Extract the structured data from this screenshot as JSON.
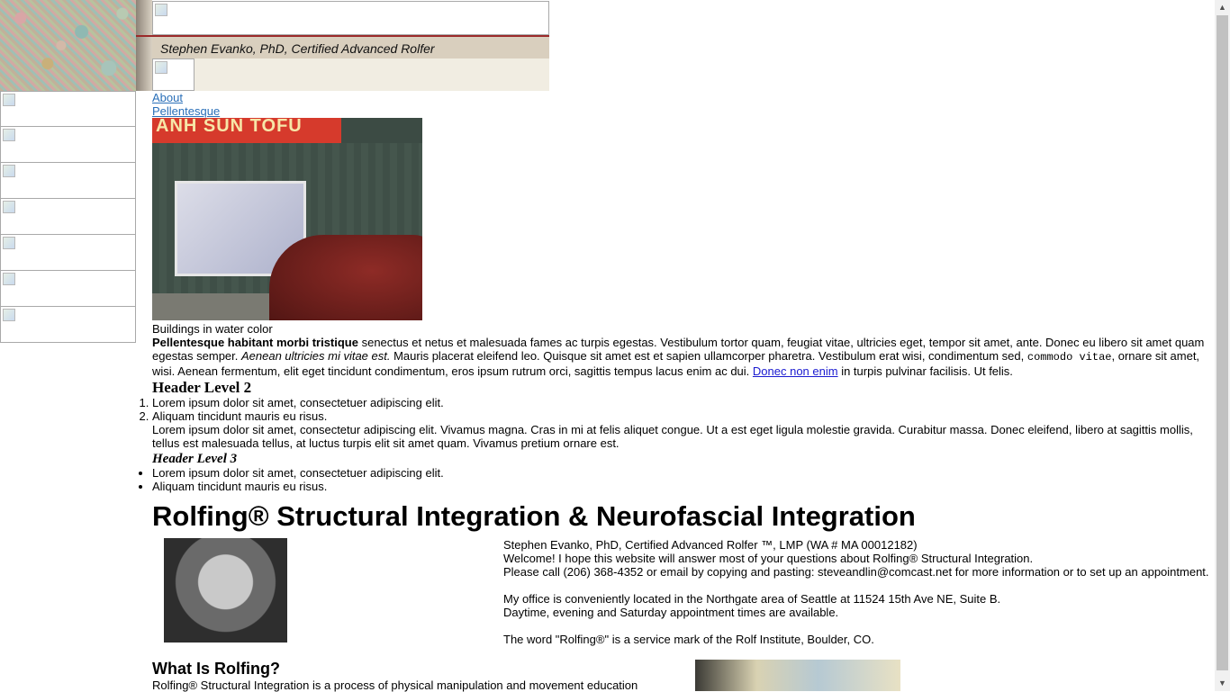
{
  "header": {
    "tagline": "Stephen Evanko, PhD, Certified Advanced Rolfer"
  },
  "nav": {
    "links": [
      "About",
      "Pellentesque"
    ]
  },
  "figure": {
    "sign_text": "ANH SUN TOFU",
    "caption": "Buildings in water color"
  },
  "article": {
    "p_bold": "Pellentesque habitant morbi tristique",
    "p_part1": " senectus et netus et malesuada fames ac turpis egestas. Vestibulum tortor quam, feugiat vitae, ultricies eget, tempor sit amet, ante. Donec eu libero sit amet quam egestas semper. ",
    "p_italic": "Aenean ultricies mi vitae est.",
    "p_part2": " Mauris placerat eleifend leo. Quisque sit amet est et sapien ullamcorper pharetra. Vestibulum erat wisi, condimentum sed, ",
    "p_code": "commodo vitae",
    "p_part3": ", ornare sit amet, wisi. Aenean fermentum, elit eget tincidunt condimentum, eros ipsum rutrum orci, sagittis tempus lacus enim ac dui. ",
    "p_link": "Donec non enim",
    "p_part4": " in turpis pulvinar facilisis. Ut felis.",
    "h2": "Header Level 2",
    "ol": [
      "Lorem ipsum dolor sit amet, consectetuer adipiscing elit.",
      "Aliquam tincidunt mauris eu risus."
    ],
    "blockquote": "Lorem ipsum dolor sit amet, consectetur adipiscing elit. Vivamus magna. Cras in mi at felis aliquet congue. Ut a est eget ligula molestie gravida. Curabitur massa. Donec eleifend, libero at sagittis mollis, tellus est malesuada tellus, at luctus turpis elit sit amet quam. Vivamus pretium ornare est.",
    "h3": "Header Level 3",
    "ul": [
      "Lorem ipsum dolor sit amet, consectetuer adipiscing elit.",
      "Aliquam tincidunt mauris eu risus."
    ]
  },
  "main": {
    "title": "Rolfing® Structural Integration & Neurofascial Integration",
    "info_lines": [
      "Stephen Evanko, PhD, Certified Advanced Rolfer ™, LMP (WA # MA 00012182)",
      " Welcome! I hope this website will answer most of your questions about Rolfing® Structural Integration.",
      "Please call (206) 368-4352 or email by copying and pasting: steveandlin@comcast.net for more information or to set up an appointment.",
      "",
      "My office is conveniently located in the Northgate area of Seattle at 11524 15th Ave NE, Suite B.",
      "Daytime, evening and Saturday appointment times are available.",
      "",
      "The word \"Rolfing®\" is a service mark of the Rolf Institute, Boulder, CO."
    ],
    "what_heading": "What Is Rolfing?",
    "what_text": "Rolfing® Structural Integration is a process of physical manipulation and movement education"
  }
}
